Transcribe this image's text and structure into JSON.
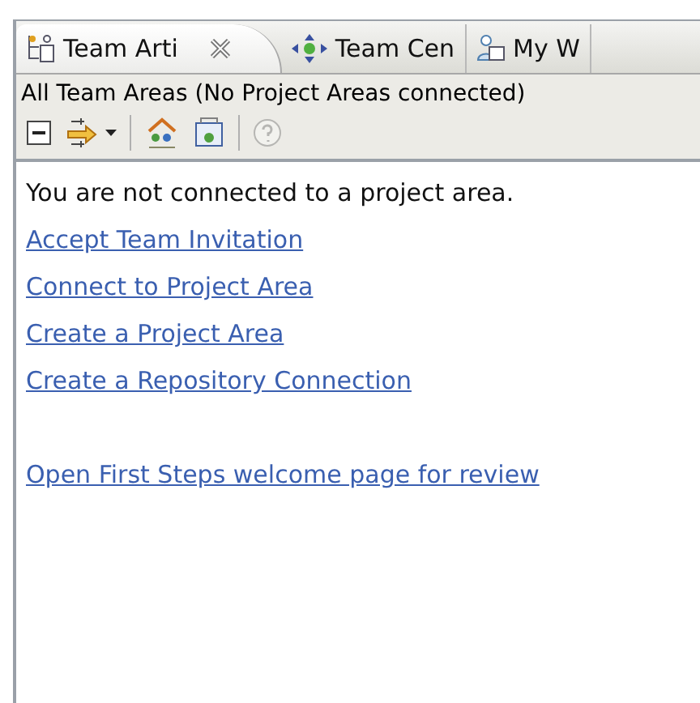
{
  "tabs": [
    {
      "label": "Team Arti",
      "selected": true,
      "kind": "artifacts"
    },
    {
      "label": "Team Cen",
      "selected": false,
      "kind": "central"
    },
    {
      "label": "My W",
      "selected": false,
      "kind": "work"
    }
  ],
  "view_title": "All Team Areas (No Project Areas connected)",
  "toolbar": [
    {
      "kind": "collapse",
      "disabled": false
    },
    {
      "kind": "sync",
      "disabled": false
    },
    {
      "kind": "separator"
    },
    {
      "kind": "team",
      "disabled": false
    },
    {
      "kind": "repository",
      "disabled": false
    },
    {
      "kind": "separator"
    },
    {
      "kind": "help",
      "disabled": true
    }
  ],
  "message": "You are not connected to a project area.",
  "links": [
    "Accept Team Invitation",
    "Connect to Project Area",
    "Create a Project Area",
    "Create a Repository Connection"
  ],
  "footer_link": "Open First Steps welcome page for review"
}
